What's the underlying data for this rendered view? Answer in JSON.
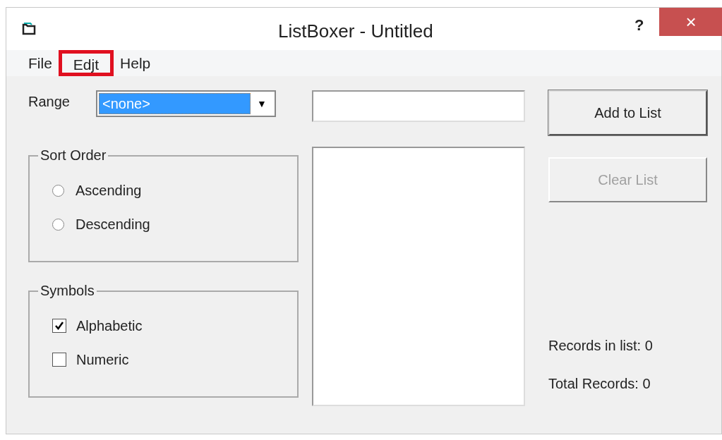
{
  "window": {
    "title": "ListBoxer - Untitled",
    "help": "?",
    "close": "×"
  },
  "menu": [
    {
      "label": "File",
      "highlighted": false
    },
    {
      "label": "Edjt",
      "highlighted": true
    },
    {
      "label": "Help",
      "highlighted": false
    }
  ],
  "range": {
    "label": "Range",
    "value": "<none>",
    "arrow": "▼"
  },
  "sort_order": {
    "title": "Sort Order",
    "options": [
      {
        "label": "Ascending",
        "selected": false
      },
      {
        "label": "Descending",
        "selected": false
      }
    ]
  },
  "symbols": {
    "title": "Symbols",
    "options": [
      {
        "label": "Alphabetic",
        "checked": true
      },
      {
        "label": "Numeric",
        "checked": false
      }
    ]
  },
  "buttons": [
    {
      "label": "Add to List",
      "disabled": false
    },
    {
      "label": "Clear List",
      "disabled": true
    }
  ],
  "stats": [
    "Records in list: 0",
    "Total Records: 0"
  ]
}
